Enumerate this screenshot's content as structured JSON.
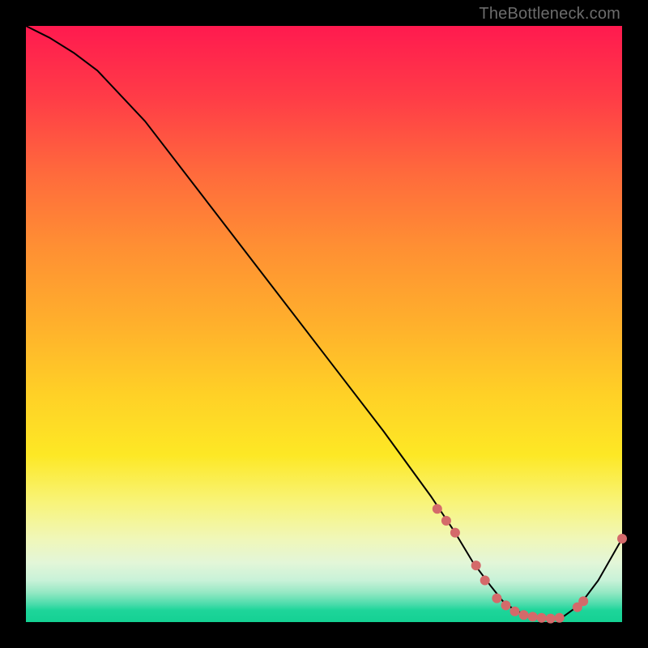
{
  "watermark": "TheBottleneck.com",
  "chart_data": {
    "type": "line",
    "title": "",
    "xlabel": "",
    "ylabel": "",
    "xlim": [
      0,
      100
    ],
    "ylim": [
      0,
      100
    ],
    "grid": false,
    "series": [
      {
        "name": "bottleneck-curve",
        "x": [
          0,
          4,
          8,
          12,
          20,
          30,
          40,
          50,
          60,
          68,
          72,
          75,
          78,
          80,
          82,
          84,
          86,
          88,
          90,
          93,
          96,
          100
        ],
        "y": [
          100,
          98,
          95.5,
          92.5,
          84,
          71,
          58,
          45,
          32,
          21,
          15,
          10,
          6,
          3.5,
          2,
          1.2,
          0.8,
          0.6,
          0.8,
          3,
          7,
          14
        ]
      }
    ],
    "markers": {
      "x": [
        69,
        70.5,
        72,
        75.5,
        77,
        79,
        80.5,
        82,
        83.5,
        85,
        86.5,
        88,
        89.5,
        92.5,
        93.5,
        100
      ],
      "y": [
        19,
        17,
        15,
        9.5,
        7,
        4,
        2.8,
        1.8,
        1.2,
        0.9,
        0.7,
        0.6,
        0.7,
        2.5,
        3.5,
        14
      ]
    },
    "annotations": [
      {
        "text": "",
        "x": 81,
        "y": 1.5
      }
    ]
  },
  "colors": {
    "curve": "#000000",
    "marker": "#d46a6a",
    "watermark": "#6c6c6c"
  }
}
